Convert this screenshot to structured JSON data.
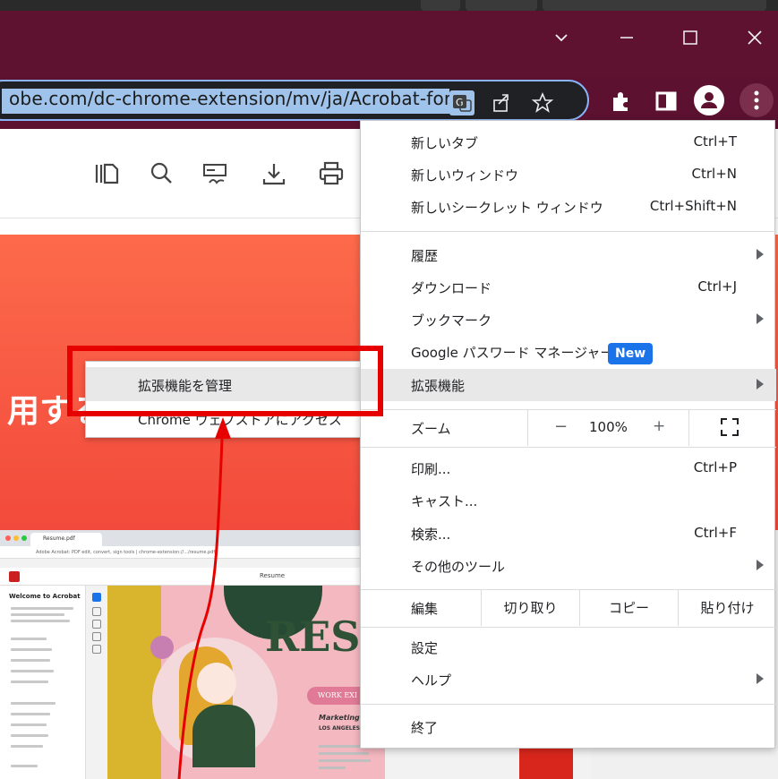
{
  "browser": {
    "address_text": "obe.com/dc-chrome-extension/mv/ja/Acrobat-for-C",
    "window_controls": [
      "chevron-down-icon",
      "minimize-icon",
      "maximize-icon",
      "close-icon"
    ],
    "omnibox_icons": [
      "translate-icon",
      "share-icon",
      "star-icon"
    ],
    "toolbar_icons": [
      "puzzle-extensions-icon",
      "side-panel-icon",
      "profile-icon",
      "kebab-menu-icon"
    ]
  },
  "pdf_toolbar": {
    "icons": [
      "thumbnails-icon",
      "search-icon",
      "fill-sign-icon",
      "download-icon",
      "print-icon"
    ]
  },
  "page": {
    "hero_text": "用する"
  },
  "embedded": {
    "tab_label": "Resume.pdf",
    "url": "Adobe Acrobat: PDF edit, convert, sign tools | chrome-extension://.../resume.pdf",
    "doc_tab": "Resume",
    "sidebar_title": "Welcome to Acrobat",
    "resume_title": "RESU",
    "work_label": "WORK EXI",
    "marketing": "Marketing M",
    "location": "LOS ANGELES, C"
  },
  "menu": {
    "items": [
      {
        "label": "新しいタブ",
        "shortcut": "Ctrl+T"
      },
      {
        "label": "新しいウィンドウ",
        "shortcut": "Ctrl+N"
      },
      {
        "label": "新しいシークレット ウィンドウ",
        "shortcut": "Ctrl+Shift+N"
      },
      {
        "label": "履歴",
        "shortcut": ""
      },
      {
        "label": "ダウンロード",
        "shortcut": "Ctrl+J"
      },
      {
        "label": "ブックマーク",
        "shortcut": ""
      },
      {
        "label": "Google パスワード マネージャー",
        "shortcut": ""
      },
      {
        "label": "拡張機能",
        "shortcut": ""
      },
      {
        "label": "印刷...",
        "shortcut": "Ctrl+P"
      },
      {
        "label": "キャスト...",
        "shortcut": ""
      },
      {
        "label": "検索...",
        "shortcut": "Ctrl+F"
      },
      {
        "label": "その他のツール",
        "shortcut": ""
      },
      {
        "label": "設定",
        "shortcut": ""
      },
      {
        "label": "ヘルプ",
        "shortcut": ""
      },
      {
        "label": "終了",
        "shortcut": ""
      }
    ],
    "new_badge": "New",
    "zoom": {
      "label": "ズーム",
      "minus": "−",
      "value": "100%",
      "plus": "+"
    },
    "edit": {
      "label": "編集",
      "cut": "切り取り",
      "copy": "コピー",
      "paste": "貼り付け"
    }
  },
  "submenu": {
    "items": [
      {
        "label": "拡張機能を管理"
      },
      {
        "label": "Chrome ウェブストアにアクセス"
      }
    ]
  },
  "colors": {
    "titlebar": "#5f1230",
    "highlight_box": "#e60000",
    "new_badge": "#1a73e8"
  }
}
